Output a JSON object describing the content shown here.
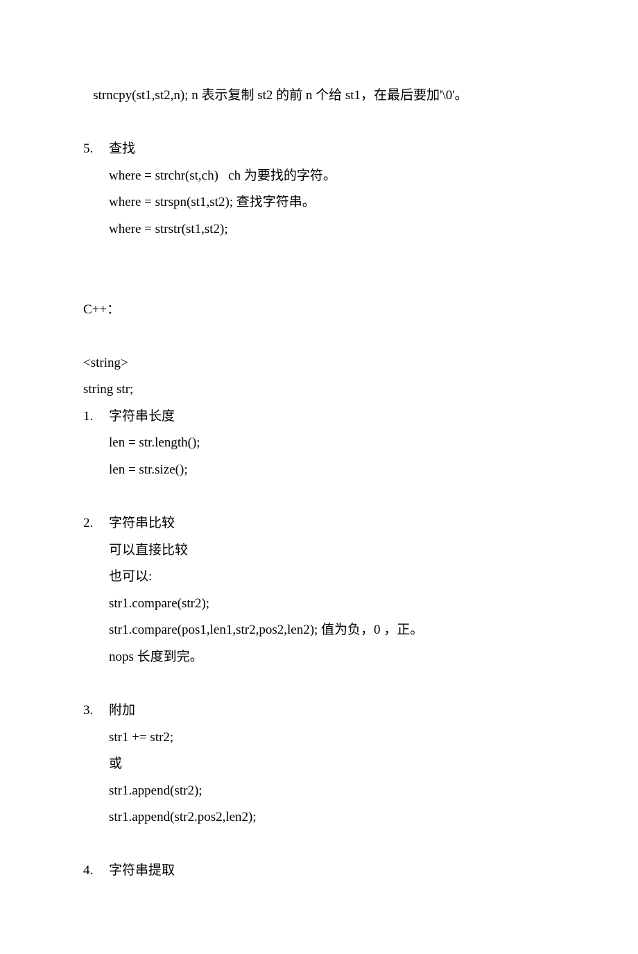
{
  "lines": {
    "l1": "   strncpy(st1,st2,n); n 表示复制 st2 的前 n 个给 st1，在最后要加'\\0'。",
    "s5_num": "5.",
    "s5_title": "查找",
    "l5a": "where = strchr(st,ch)   ch 为要找的字符。",
    "l5b": "where = strspn(st1,st2); 查找字符串。",
    "l5c": "where = strstr(st1,st2);",
    "cpp": "C++：",
    "inc": "<string>",
    "decl": "string str;",
    "s1_num": "1.",
    "s1_title": "字符串长度",
    "l1a": "len = str.length();",
    "l1b": "len = str.size();",
    "s2_num": "2.",
    "s2_title": "字符串比较",
    "l2a": "可以直接比较",
    "l2b": "也可以:",
    "l2c": "str1.compare(str2);",
    "l2d": "str1.compare(pos1,len1,str2,pos2,len2); 值为负，0 ，正。",
    "l2e": "nops 长度到完。",
    "s3_num": "3.",
    "s3_title": "附加",
    "l3a": "str1 += str2;",
    "l3b": "或",
    "l3c": "str1.append(str2);",
    "l3d": "str1.append(str2.pos2,len2);",
    "s4_num": "4.",
    "s4_title": "字符串提取"
  }
}
